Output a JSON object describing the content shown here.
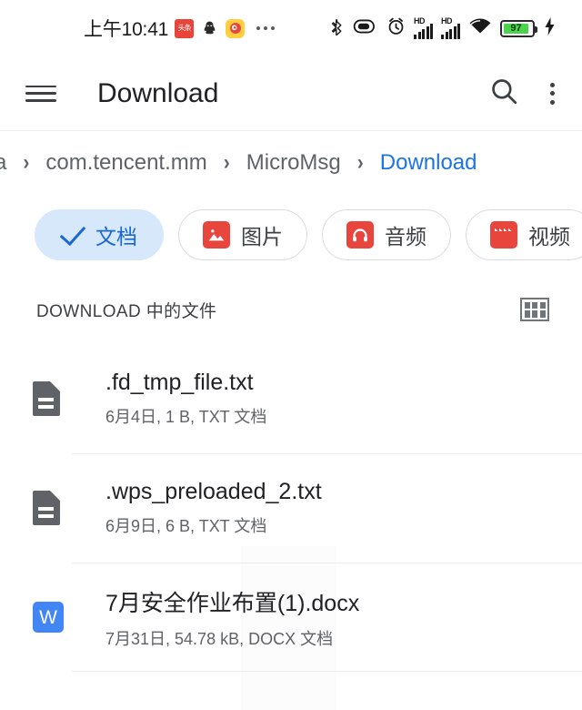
{
  "statusbar": {
    "time": "上午10:41",
    "notification_icons": [
      {
        "name": "toutiao-icon",
        "label": "头条"
      },
      {
        "name": "qq-icon",
        "label": "QQ"
      },
      {
        "name": "weibo-icon",
        "label": "微博"
      }
    ],
    "overflow_indicator": "...",
    "system_icons": [
      {
        "name": "bluetooth-icon"
      },
      {
        "name": "vibrate-mode-icon"
      },
      {
        "name": "alarm-clock-icon"
      },
      {
        "name": "signal-sim1-icon",
        "label": "HD"
      },
      {
        "name": "signal-sim2-icon",
        "label": "HD"
      },
      {
        "name": "wifi-icon"
      }
    ],
    "battery": {
      "level": "97",
      "charging": true,
      "fill_color": "#4bd44b"
    }
  },
  "appbar": {
    "menu_icon": "menu-icon",
    "title": "Download",
    "search_icon": "search-icon",
    "overflow_icon": "more-vertical-icon"
  },
  "breadcrumb": {
    "separator": "›",
    "items": [
      {
        "label": "a",
        "active": false,
        "clipped": true
      },
      {
        "label": "com.tencent.mm",
        "active": false
      },
      {
        "label": "MicroMsg",
        "active": false
      },
      {
        "label": "Download",
        "active": true
      }
    ]
  },
  "filters": {
    "chips": [
      {
        "label": "文档",
        "icon": "check-icon",
        "selected": true
      },
      {
        "label": "图片",
        "icon": "image-icon",
        "selected": false
      },
      {
        "label": "音频",
        "icon": "headphone-icon",
        "selected": false
      },
      {
        "label": "视频",
        "icon": "video-clapper-icon",
        "selected": false
      },
      {
        "label": "",
        "icon": "tag-icon",
        "selected": false
      }
    ],
    "accent_selected_bg": "#d7e8fb",
    "accent_selected_text": "#1967d2",
    "icon_red": "#e8453c"
  },
  "section": {
    "title": "DOWNLOAD 中的文件",
    "view_toggle_icon": "grid-view-icon"
  },
  "files": [
    {
      "name": ".fd_tmp_file.txt",
      "subtitle": "6月4日, 1 B, TXT 文档",
      "icon": "text-document-icon",
      "icon_type": "doc"
    },
    {
      "name": ".wps_preloaded_2.txt",
      "subtitle": "6月9日, 6 B, TXT 文档",
      "icon": "text-document-icon",
      "icon_type": "doc"
    },
    {
      "name": "7月安全作业布置(1).docx",
      "subtitle": "7月31日, 54.78 kB, DOCX 文档",
      "icon": "word-document-icon",
      "icon_type": "word",
      "icon_letter": "W",
      "icon_color": "#4285f4"
    }
  ]
}
